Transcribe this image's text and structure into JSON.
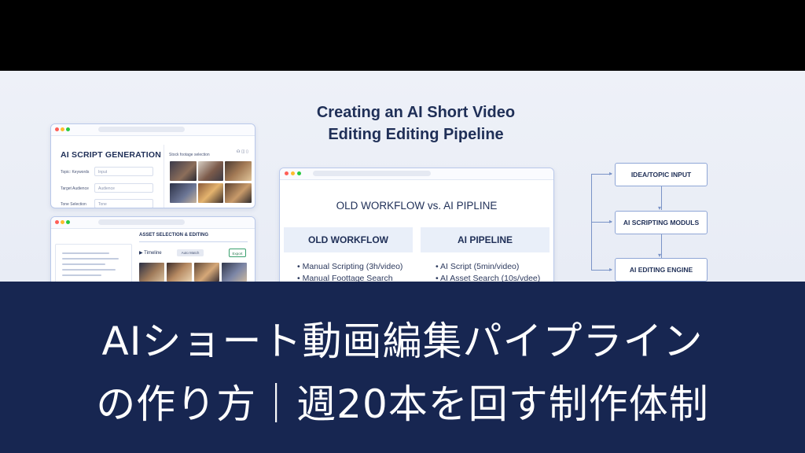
{
  "headline": {
    "line1": "Creating an AI Short Video",
    "line2": "Editing Editing Pipeline"
  },
  "script_window": {
    "title": "AI SCRIPT GENERATION",
    "rows": [
      {
        "label": "Topic: Keywords",
        "input": "Input"
      },
      {
        "label": "Target Audience",
        "input": "Audience"
      },
      {
        "label": "Tone Selection",
        "input": "Tone"
      }
    ],
    "stock_label": "Stock footage selection",
    "controls": "☊ ◫ ▯"
  },
  "edit_window": {
    "heading": "ASSET SELECTION & EDITING",
    "play_label": "▶ Timeline",
    "pill_label": "Auto Match",
    "export_label": "Export"
  },
  "compare_window": {
    "title": "OLD WORKFLOW vs. AI PIPLINE",
    "left": {
      "header": "OLD WORKFLOW",
      "items": [
        "• Manual Scripting (3h/video)",
        "• Manual Foottage Search"
      ]
    },
    "right": {
      "header": "AI PIPELINE",
      "items": [
        "• AI Script (5min/video)",
        "• AI Asset Search (10s/vdee)"
      ]
    }
  },
  "flow": {
    "steps": [
      "IDEA/TOPIC INPUT",
      "AI SCRIPTING MODULS",
      "AI EDITING ENGINE"
    ]
  },
  "caption": {
    "line1": "AIショート動画編集パイプライン",
    "line2": "の作り方｜週20本を回す制作体制"
  }
}
